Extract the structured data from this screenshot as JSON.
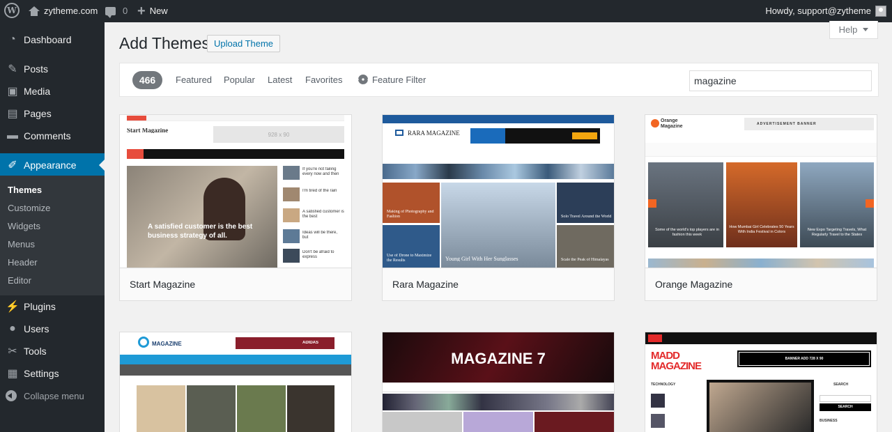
{
  "admin_bar": {
    "site_name": "zytheme.com",
    "comments_count": "0",
    "new_label": "New",
    "greeting": "Howdy, support@zytheme"
  },
  "sidebar": {
    "items": [
      {
        "label": "Dashboard",
        "icon": "dashboard-icon"
      },
      {
        "label": "Posts",
        "icon": "pin-icon"
      },
      {
        "label": "Media",
        "icon": "media-icon"
      },
      {
        "label": "Pages",
        "icon": "pages-icon"
      },
      {
        "label": "Comments",
        "icon": "comments-icon"
      },
      {
        "label": "Appearance",
        "icon": "brush-icon"
      },
      {
        "label": "Plugins",
        "icon": "plugin-icon"
      },
      {
        "label": "Users",
        "icon": "users-icon"
      },
      {
        "label": "Tools",
        "icon": "wrench-icon"
      },
      {
        "label": "Settings",
        "icon": "settings-icon"
      }
    ],
    "submenu": [
      "Themes",
      "Customize",
      "Widgets",
      "Menus",
      "Header",
      "Editor"
    ],
    "collapse_label": "Collapse menu"
  },
  "page": {
    "title": "Add Themes",
    "upload_button": "Upload Theme",
    "help_label": "Help"
  },
  "filter": {
    "count": "466",
    "links": [
      "Featured",
      "Popular",
      "Latest",
      "Favorites"
    ],
    "feature_filter": "Feature Filter",
    "search_value": "magazine"
  },
  "themes": [
    {
      "name": "Start Magazine",
      "logo": "Start Magazine",
      "ad": "928 x 90",
      "headline": "A satisfied customer is the best business strategy of all.",
      "side_posts": [
        "If you're not failing every now and then",
        "I'm tired of the rain",
        "A satisfied customer is the best",
        "Ideas will be there, but",
        "Don't be afraid to express"
      ]
    },
    {
      "name": "Rara Magazine",
      "logo": "RARA MAGAZINE",
      "captions": [
        "Making of Photography and Fashion",
        "Young Girl With Her Sunglasses",
        "Solo Travel Around the World",
        "Use of Drone to Maximize the Results",
        "Scale the Peak of Himalayas"
      ]
    },
    {
      "name": "Orange Magazine",
      "logo": "Orange Magazine",
      "ad": "ADVERTISEMENT BANNER",
      "captions": [
        "Some of the world's top players are in fashion this week",
        "How Mumbai Girl Celebrates 50 Years With India Festival in Colors",
        "New Expo Targeting Travels, What Regularly Travel to the States"
      ]
    },
    {
      "name": "",
      "logo": "MAGAZINE",
      "ad": "ADIDAS"
    },
    {
      "name": "",
      "logo": "MAGAZINE 7"
    },
    {
      "name": "",
      "logo": "MADD MAGAZINE",
      "ad": "BANNER ADD 728 X 90",
      "widget_titles": [
        "TECHNOLOGY",
        "SEARCH",
        "BUSINESS"
      ],
      "search_button": "SEARCH"
    }
  ],
  "colors": {
    "admin_bar": "#23282d",
    "accent": "#0073aa",
    "submenu_bg": "#32373c",
    "page_bg": "#f1f1f1"
  }
}
